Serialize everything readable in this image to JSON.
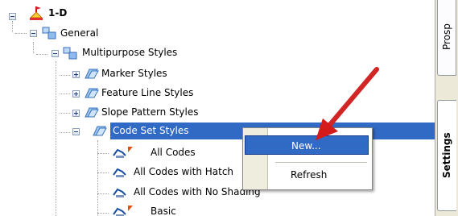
{
  "tree": {
    "root_label": "1-D",
    "general_label": "General",
    "multipurpose_label": "Multipurpose Styles",
    "marker_label": "Marker Styles",
    "feature_line_label": "Feature Line Styles",
    "slope_pattern_label": "Slope Pattern Styles",
    "code_set_label": "Code Set Styles",
    "all_codes_label": "All Codes",
    "all_codes_hatch_label": "All Codes with Hatch",
    "all_codes_no_shading_label": "All Codes with No Shading",
    "basic_label": "Basic"
  },
  "side_tabs": {
    "prospector_label": "Prosp",
    "settings_label": "Settings"
  },
  "context_menu": {
    "new_label": "New...",
    "refresh_label": "Refresh"
  },
  "colors": {
    "selection": "#316ac5",
    "annotation_arrow": "#e01e1e"
  },
  "icons": {
    "root": "drawing-icon",
    "folder": "style-collection-icon",
    "style": "code-set-style-icon"
  }
}
